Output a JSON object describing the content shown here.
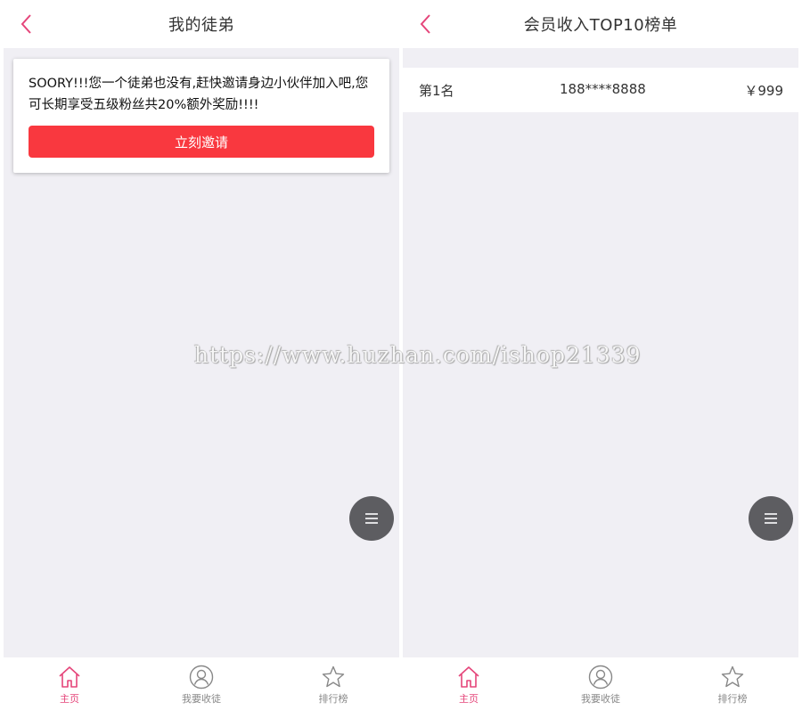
{
  "colors": {
    "accent_pink": "#e5457a",
    "invite_button": "#f9383f",
    "fab_background": "#5d5d61",
    "page_background": "#f0eff4"
  },
  "left_screen": {
    "header": {
      "title": "我的徒弟",
      "back_icon": "chevron-left-icon"
    },
    "empty_card": {
      "message": "SOORY!!!您一个徒弟也没有,赶快邀请身边小伙伴加入吧,您可长期享受五级粉丝共20%额外奖励!!!!",
      "invite_label": "立刻邀请"
    },
    "fab_icon": "menu-icon",
    "tabs": [
      {
        "label": "主页",
        "icon": "home-icon",
        "active": true
      },
      {
        "label": "我要收徒",
        "icon": "user-icon",
        "active": false
      },
      {
        "label": "排行榜",
        "icon": "star-icon",
        "active": false
      }
    ]
  },
  "right_screen": {
    "header": {
      "title": "会员收入TOP10榜单",
      "back_icon": "chevron-left-icon"
    },
    "ranking": [
      {
        "rank": "第1名",
        "phone": "188****8888",
        "amount": "￥999"
      }
    ],
    "fab_icon": "menu-icon",
    "tabs": [
      {
        "label": "主页",
        "icon": "home-icon",
        "active": true
      },
      {
        "label": "我要收徒",
        "icon": "user-icon",
        "active": false
      },
      {
        "label": "排行榜",
        "icon": "star-icon",
        "active": false
      }
    ]
  },
  "watermark": "https://www.huzhan.com/ishop21339"
}
